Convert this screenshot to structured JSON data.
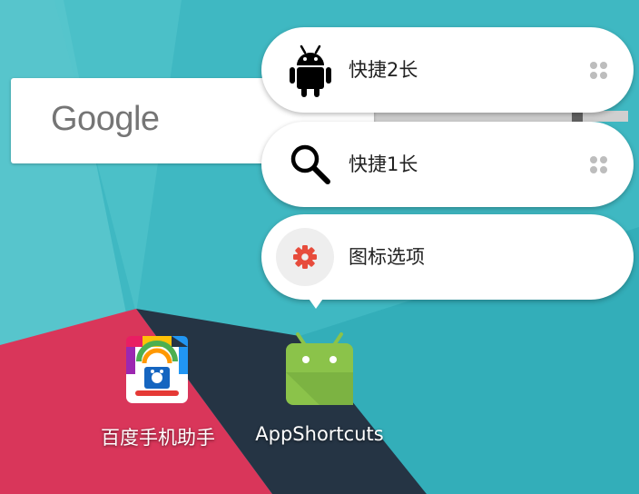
{
  "colors": {
    "wallpaper_teal": "#3fb8c2",
    "wallpaper_teal_light": "#6cd0d6",
    "wallpaper_red": "#d9365a",
    "wallpaper_navy": "#253444",
    "android_green": "#8bc34a",
    "gear_red": "#e74c3c"
  },
  "search_widget": {
    "logo_text": "Google",
    "icon": "google-logo"
  },
  "shortcut_menu": {
    "items": [
      {
        "label": "快捷2长",
        "icon": "android-icon",
        "has_drag_handle": true
      },
      {
        "label": "快捷1长",
        "icon": "search-icon",
        "has_drag_handle": true
      },
      {
        "label": "图标选项",
        "icon": "gear-icon",
        "has_drag_handle": false
      }
    ]
  },
  "apps": [
    {
      "label": "百度手机助手",
      "icon": "baidu-app-store-icon"
    },
    {
      "label": "AppShortcuts",
      "icon": "android-app-icon"
    }
  ]
}
